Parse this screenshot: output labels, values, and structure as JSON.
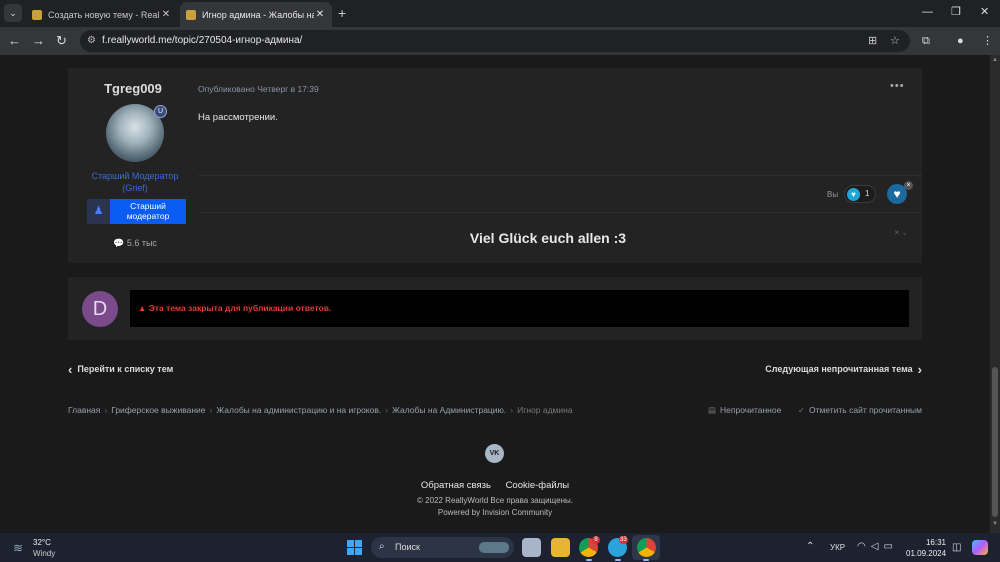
{
  "browser": {
    "tabs": [
      {
        "title": "Создать новую тему - ReallyW",
        "close": "✕",
        "active": false
      },
      {
        "title": "Игнор админа - Жалобы на Ад",
        "close": "✕",
        "active": true
      }
    ],
    "new_tab": "+",
    "url": "f.reallyworld.me/topic/270504-игнор-админа/",
    "window_controls": {
      "minimize": "—",
      "maximize": "❐",
      "close": "✕"
    }
  },
  "post": {
    "author": "Tgreg009",
    "author_badge": "U",
    "author_role": "Старший Модератор (Grief)",
    "group_label": "Старший модератор",
    "reputation": "5.6 тыс",
    "meta": "Опубликовано Четверг в 17:39",
    "menu": "•••",
    "body": "На рассмотрении.",
    "reactions": {
      "you_label": "Вы",
      "count": "1"
    },
    "signature": "Viel Glück euch allen :3"
  },
  "locked": {
    "avatar_letter": "D",
    "message": "Эта тема закрыта для публикации ответов."
  },
  "pagination": {
    "prev": "Перейти к списку тем",
    "next": "Следующая непрочитанная тема"
  },
  "breadcrumb": {
    "items": [
      "Главная",
      "Гриферское выживание",
      "Жалобы на администрацию и на игроков.",
      "Жалобы на Администрацию."
    ],
    "current": "Игнор админа",
    "unread": "Непрочитанное",
    "mark_read": "Отметить сайт прочитанным"
  },
  "footer": {
    "vk": "VK",
    "links": [
      "Обратная связь",
      "Cookie-файлы"
    ],
    "copyright": "© 2022 ReallyWorld Все права защищены.",
    "powered": "Powered by Invision Community"
  },
  "taskbar": {
    "weather_temp": "32°C",
    "weather_desc": "Windy",
    "search_placeholder": "Поиск",
    "chrome_badge": "8",
    "telegram_badge": "33",
    "language": "УКР",
    "time": "16:31",
    "date": "01.09.2024"
  },
  "colors": {
    "role_blue": "#3d6bd6",
    "group_blue": "#0a5cf5",
    "locked_red": "#e53935",
    "page_bg": "#1a1a1a",
    "card_bg": "#232323"
  }
}
